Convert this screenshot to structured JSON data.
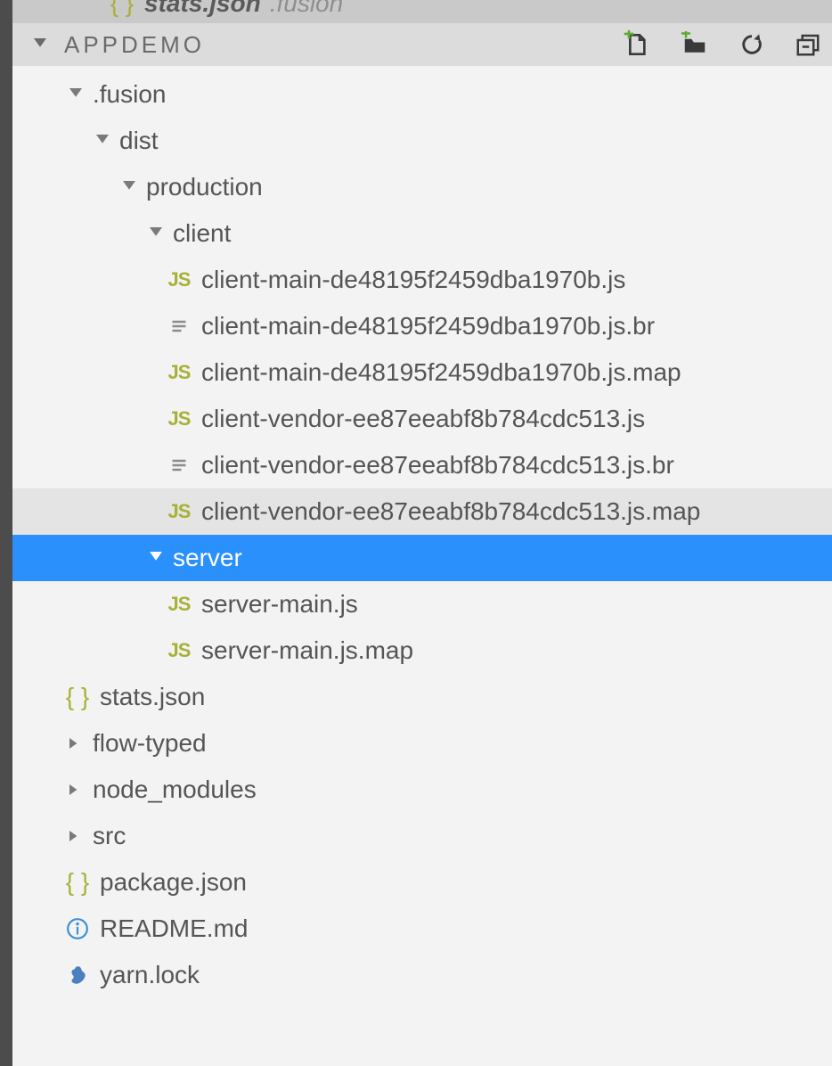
{
  "tab": {
    "file": "stats.json",
    "path": ".fusion"
  },
  "root": {
    "name": "APPDEMO"
  },
  "icons": {
    "js": "JS",
    "braces": "{ }"
  },
  "tree": {
    "fusion": ".fusion",
    "dist": "dist",
    "production": "production",
    "client": "client",
    "client_main_js": "client-main-de48195f2459dba1970b.js",
    "client_main_br": "client-main-de48195f2459dba1970b.js.br",
    "client_main_map": "client-main-de48195f2459dba1970b.js.map",
    "client_vendor_js": "client-vendor-ee87eeabf8b784cdc513.js",
    "client_vendor_br": "client-vendor-ee87eeabf8b784cdc513.js.br",
    "client_vendor_map": "client-vendor-ee87eeabf8b784cdc513.js.map",
    "server": "server",
    "server_main_js": "server-main.js",
    "server_main_map": "server-main.js.map",
    "stats_json": "stats.json",
    "flow_typed": "flow-typed",
    "node_modules": "node_modules",
    "src": "src",
    "package_json": "package.json",
    "readme": "README.md",
    "yarn_lock": "yarn.lock"
  }
}
